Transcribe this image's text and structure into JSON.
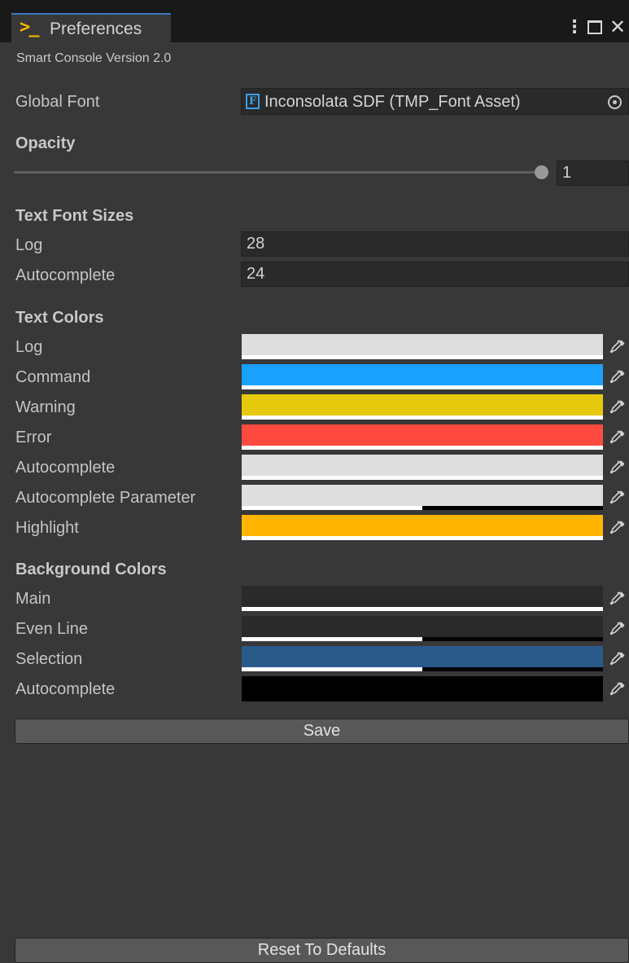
{
  "window": {
    "tab_title": "Preferences",
    "tab_icon": "terminal-icon",
    "controls": [
      "menu-icon",
      "maximize-icon",
      "close-icon"
    ]
  },
  "version": "Smart Console Version 2.0",
  "global_font": {
    "label": "Global Font",
    "value": "Inconsolata SDF (TMP_Font Asset)",
    "icon": "font-asset-icon",
    "picker_icon": "object-picker-icon"
  },
  "opacity": {
    "header": "Opacity",
    "value": "1",
    "slider_fraction": 1.0
  },
  "font_sizes": {
    "header": "Text Font Sizes",
    "items": [
      {
        "label": "Log",
        "value": "28"
      },
      {
        "label": "Autocomplete",
        "value": "24"
      }
    ]
  },
  "text_colors": {
    "header": "Text Colors",
    "items": [
      {
        "label": "Log",
        "color": "#dedede",
        "alpha": 1.0
      },
      {
        "label": "Command",
        "color": "#1aa1ff",
        "alpha": 1.0
      },
      {
        "label": "Warning",
        "color": "#e5c90a",
        "alpha": 1.0
      },
      {
        "label": "Error",
        "color": "#ff4a40",
        "alpha": 1.0
      },
      {
        "label": "Autocomplete",
        "color": "#dedede",
        "alpha": 1.0
      },
      {
        "label": "Autocomplete Parameter",
        "color": "#dedede",
        "alpha": 0.5
      },
      {
        "label": "Highlight",
        "color": "#ffb500",
        "alpha": 1.0
      }
    ]
  },
  "background_colors": {
    "header": "Background Colors",
    "items": [
      {
        "label": "Main",
        "color": "#2a2a2a",
        "alpha": 1.0
      },
      {
        "label": "Even Line",
        "color": "#2a2a2a",
        "alpha": 0.5
      },
      {
        "label": "Selection",
        "color": "#2a5a8a",
        "alpha": 0.5
      },
      {
        "label": "Autocomplete",
        "color": "#000000",
        "alpha": 0.0
      }
    ]
  },
  "buttons": {
    "save": "Save",
    "reset": "Reset To Defaults"
  }
}
